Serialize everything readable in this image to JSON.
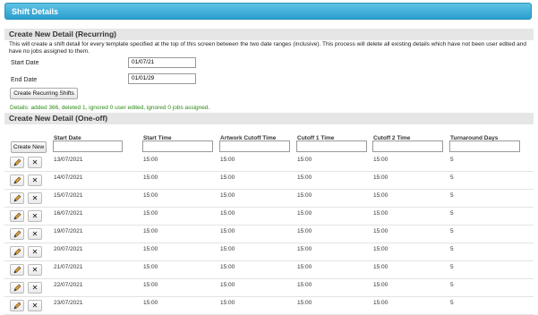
{
  "header": {
    "title": "Shift Details"
  },
  "recurring": {
    "heading": "Create New Detail (Recurring)",
    "description": "This will create a shift detail for every template specified at the top of this screen between the two date ranges (inclusive). This process will delete all existing details which have not been user edited and have no jobs assigned to them.",
    "start_label": "Start Date",
    "start_value": "01/07/21",
    "end_label": "End Date",
    "end_value": "01/01/29",
    "button_label": "Create Recurring Shifts",
    "status": "Details: added 366, deleted 1, ignored 0 user edited, ignored 0 jobs assigned."
  },
  "oneoff": {
    "heading": "Create New Detail (One-off)",
    "create_button": "Create New",
    "columns": [
      "Start Date",
      "Start Time",
      "Artwork Cutoff Time",
      "Cutoff 1 Time",
      "Cutoff 2 Time",
      "Turnaround Days"
    ]
  },
  "icons": {
    "edit": "pencil-icon",
    "delete": "close-icon"
  },
  "rows": [
    [
      "13/07/2021",
      "15:00",
      "15:00",
      "15:00",
      "15:00",
      "5"
    ],
    [
      "14/07/2021",
      "15:00",
      "15:00",
      "15:00",
      "15:00",
      "5"
    ],
    [
      "15/07/2021",
      "15:00",
      "15:00",
      "15:00",
      "15:00",
      "5"
    ],
    [
      "16/07/2021",
      "15:00",
      "15:00",
      "15:00",
      "15:00",
      "5"
    ],
    [
      "19/07/2021",
      "15:00",
      "15:00",
      "15:00",
      "15:00",
      "5"
    ],
    [
      "20/07/2021",
      "15:00",
      "15:00",
      "15:00",
      "15:00",
      "5"
    ],
    [
      "21/07/2021",
      "15:00",
      "15:00",
      "15:00",
      "15:00",
      "5"
    ],
    [
      "22/07/2021",
      "15:00",
      "15:00",
      "15:00",
      "15:00",
      "5"
    ],
    [
      "23/07/2021",
      "15:00",
      "15:00",
      "15:00",
      "15:00",
      "5"
    ]
  ]
}
